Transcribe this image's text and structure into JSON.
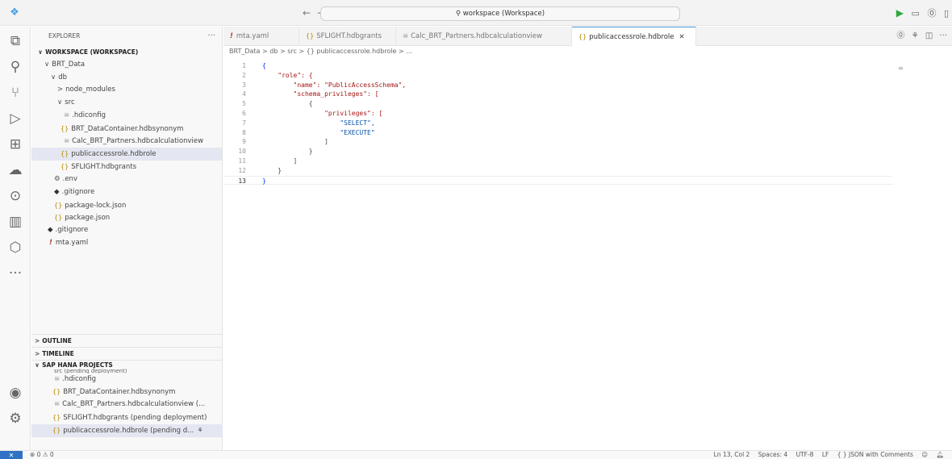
{
  "titlebar": {
    "search": "⚲ workspace (Workspace)",
    "back": "←",
    "forward": "→",
    "run_icon": "play-icon"
  },
  "sidebar": {
    "title": "EXPLORER",
    "more": "···",
    "tree": [
      {
        "label": "WORKSPACE (WORKSPACE)",
        "prefix": "∨",
        "kind": "root"
      },
      {
        "label": "BRT_Data",
        "prefix": "∨"
      },
      {
        "label": "db",
        "prefix": "∨"
      },
      {
        "label": "node_modules",
        "prefix": ">"
      },
      {
        "label": "src",
        "prefix": "∨"
      },
      {
        "label": ".hdiconfig",
        "icon": "lines"
      },
      {
        "label": "BRT_DataContainer.hdbsynonym",
        "icon": "json"
      },
      {
        "label": "Calc_BRT_Partners.hdbcalculationview",
        "icon": "lines"
      },
      {
        "label": "publicaccessrole.hdbrole",
        "icon": "json",
        "selected": true
      },
      {
        "label": "SFLIGHT.hdbgrants",
        "icon": "json"
      },
      {
        "label": ".env",
        "icon": "gear"
      },
      {
        "label": ".gitignore",
        "icon": "diamond"
      },
      {
        "label": "package-lock.json",
        "icon": "json"
      },
      {
        "label": "package.json",
        "icon": "json"
      },
      {
        "label": ".gitignore",
        "icon": "diamond"
      },
      {
        "label": "mta.yaml",
        "icon": "yaml"
      }
    ],
    "outline": "OUTLINE",
    "timeline": "TIMELINE",
    "sap": "SAP HANA PROJECTS",
    "sap_cut": "src  (pending deployment)",
    "sap_items": [
      {
        "label": ".hdiconfig",
        "icon": "lines"
      },
      {
        "label": "BRT_DataContainer.hdbsynonym",
        "icon": "json"
      },
      {
        "label": "Calc_BRT_Partners.hdbcalculationview (...",
        "icon": "lines"
      },
      {
        "label": "SFLIGHT.hdbgrants  (pending deployment)",
        "icon": "json"
      },
      {
        "label": "publicaccessrole.hdbrole  (pending d...",
        "icon": "json"
      }
    ]
  },
  "tabs": [
    {
      "label": "mta.yaml",
      "icon": "!"
    },
    {
      "label": "SFLIGHT.hdbgrants",
      "icon": "{}"
    },
    {
      "label": "Calc_BRT_Partners.hdbcalculationview",
      "icon": "≡"
    },
    {
      "label": "publicaccessrole.hdbrole",
      "icon": "{}",
      "active": true
    }
  ],
  "breadcrumb": "BRT_Data > db > src > {} publicaccessrole.hdbrole > ...",
  "code": [
    {
      "n": "1",
      "t": "{"
    },
    {
      "n": "2",
      "t": "    \"role\": {"
    },
    {
      "n": "3",
      "t": "        \"name\": \"PublicAccessSchema\","
    },
    {
      "n": "4",
      "t": "        \"schema_privileges\": ["
    },
    {
      "n": "5",
      "t": "            {"
    },
    {
      "n": "6",
      "t": "                \"privileges\": ["
    },
    {
      "n": "7",
      "t": "                    \"SELECT\","
    },
    {
      "n": "8",
      "t": "                    \"EXECUTE\""
    },
    {
      "n": "9",
      "t": "                ]"
    },
    {
      "n": "10",
      "t": "            }"
    },
    {
      "n": "11",
      "t": "        ]"
    },
    {
      "n": "12",
      "t": "    }"
    },
    {
      "n": "13",
      "t": "}"
    }
  ],
  "status": {
    "remote": "✕",
    "problems": "⊗ 0 ⚠ 0",
    "position": "Ln 13, Col 2",
    "spaces": "Spaces: 4",
    "encoding": "UTF-8",
    "eol": "LF",
    "language": "{ } JSON with Comments"
  }
}
